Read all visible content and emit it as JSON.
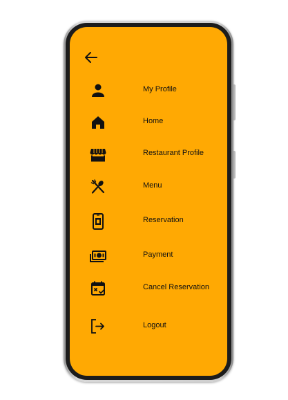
{
  "app": {
    "accent_color": "#FFA903",
    "text_color": "#111111"
  },
  "nav": {
    "back_icon": "arrow-left-icon"
  },
  "menu": {
    "items": [
      {
        "label": "My Profile",
        "icon": "person-icon"
      },
      {
        "label": "Home",
        "icon": "home-icon"
      },
      {
        "label": "Restaurant Profile",
        "icon": "storefront-icon"
      },
      {
        "label": "Menu",
        "icon": "fork-spoon-icon"
      },
      {
        "label": "Reservation",
        "icon": "reservation-phone-icon"
      },
      {
        "label": "Payment",
        "icon": "payments-icon"
      },
      {
        "label": "Cancel Reservation",
        "icon": "calendar-cancel-icon"
      },
      {
        "label": "Logout",
        "icon": "logout-icon"
      }
    ]
  }
}
